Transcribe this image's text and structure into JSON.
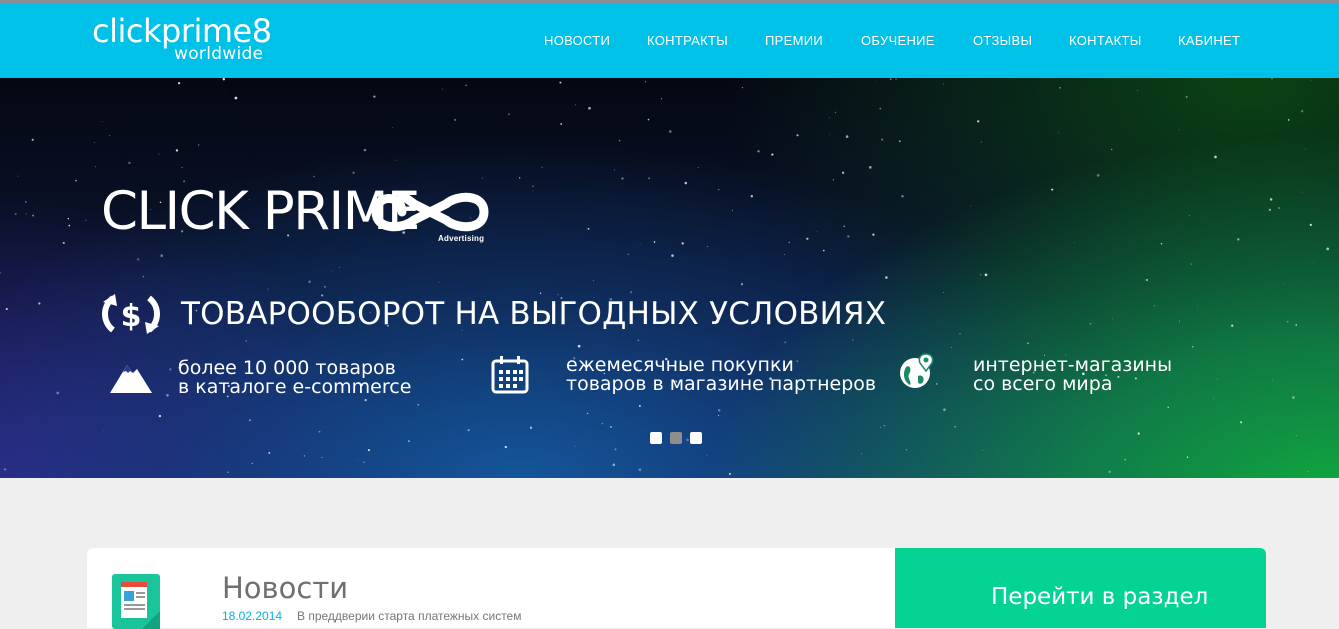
{
  "header": {
    "logo_main": "clickprime8",
    "logo_sub": "worldwide",
    "nav": [
      "НОВОСТИ",
      "КОНТРАКТЫ",
      "ПРЕМИИ",
      "ОБУЧЕНИЕ",
      "ОТЗЫВЫ",
      "КОНТАКТЫ",
      "КАБИНЕТ"
    ],
    "bg_color": "#00c1e8"
  },
  "hero": {
    "brand": "CLICK PRIME",
    "brand_sub": "Advertising",
    "headline": "ТОВАРООБОРОТ НА ВЫГОДНЫХ УСЛОВИЯХ",
    "features": [
      {
        "icon": "mountain-icon",
        "line1": "более 10 000 товаров",
        "line2": "в каталоге e-commerce"
      },
      {
        "icon": "calendar-icon",
        "line1": "ежемесячные покупки",
        "line2": "товаров в магазине партнеров"
      },
      {
        "icon": "globe-pin-icon",
        "line1": "интернет-магазины",
        "line2": "со всего мира"
      }
    ],
    "slider_active_index": 1,
    "slider_count": 3
  },
  "news": {
    "title": "Новости",
    "date": "18.02.2014",
    "text": "В преддверии старта платежных систем",
    "button_label": "Перейти в раздел",
    "button_color": "#04d394"
  }
}
